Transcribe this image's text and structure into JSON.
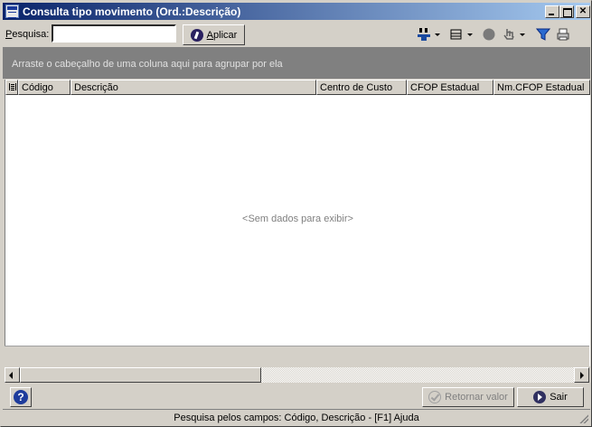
{
  "window": {
    "title": "Consulta tipo movimento (Ord.:Descrição)",
    "app_icon": "app-window-icon",
    "controls": {
      "minimize": "_",
      "maximize": "□",
      "close": "✕"
    }
  },
  "search": {
    "label_underlined": "P",
    "label_rest": "esquisa:",
    "value": "",
    "apply_label": "Aplicar",
    "apply_underlined": "A"
  },
  "toolbar": {
    "icons": [
      "columns-select-icon",
      "layout-icon",
      "record-icon",
      "hand-icon",
      "filter-icon",
      "print-icon"
    ]
  },
  "grid": {
    "group_panel_text": "Arraste o cabeçalho de uma coluna aqui para agrupar por ela",
    "columns": [
      "Código",
      "Descrição",
      "Centro de Custo",
      "CFOP Estadual",
      "Nm.CFOP Estadual"
    ],
    "empty_text": "<Sem dados para exibir>"
  },
  "actions": {
    "return_label": "Retornar valor",
    "exit_label": "Sair"
  },
  "status": {
    "text": "Pesquisa pelos campos: Código, Descrição - [F1] Ajuda"
  },
  "colors": {
    "title_start": "#0a246a",
    "title_end": "#a6caf0",
    "face": "#d4d0c8",
    "group_panel": "#808080"
  }
}
